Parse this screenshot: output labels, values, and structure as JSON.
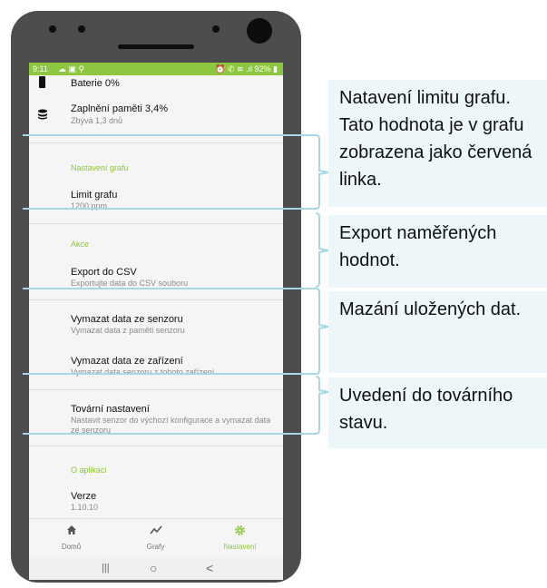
{
  "statusbar": {
    "time": "9:11",
    "left_icons": "☁ ▣ ⚲",
    "right_icons": "⏰ ✆ ≋ .ıl 92% ▮"
  },
  "items": {
    "battery": {
      "title": "Baterie 0%"
    },
    "memory": {
      "title": "Zaplnění paměti 3,4%",
      "subtitle": "Zbývá 1,3 dnů"
    },
    "section_graph": "Nastavení grafu",
    "graph_limit": {
      "title": "Limit grafu",
      "subtitle": "1200 ppm"
    },
    "section_actions": "Akce",
    "export_csv": {
      "title": "Export do CSV",
      "subtitle": "Exportujte data do CSV souboru"
    },
    "clear_sensor": {
      "title": "Vymazat data ze senzoru",
      "subtitle": "Vymazat data z paměti senzoru"
    },
    "clear_device": {
      "title": "Vymazat data ze zařízení",
      "subtitle": "Vymazat data senzoru z tohoto zařízení"
    },
    "factory_reset": {
      "title": "Tovární nastavení",
      "subtitle": "Nastavit senzor do výchozí konfigurace a vymazat data ze senzoru"
    },
    "section_about": "O aplikaci",
    "version": {
      "title": "Verze",
      "subtitle": "1.10.10"
    }
  },
  "bottom_nav": [
    {
      "label": "Domů",
      "icon": "home-icon",
      "glyph": "⌂"
    },
    {
      "label": "Grafy",
      "icon": "chart-icon",
      "glyph": "⟋"
    },
    {
      "label": "Nastavení",
      "icon": "gear-icon",
      "glyph": "⚙",
      "active": true
    }
  ],
  "system_nav": {
    "recent": "|||",
    "home": "○",
    "back": "<"
  },
  "callouts": [
    {
      "text": "Natavení limitu grafu. Tato hodnota je v grafu zobrazena jako červená linka."
    },
    {
      "text": "Export naměřených hodnot."
    },
    {
      "text": "Mazání uložených dat."
    },
    {
      "text": "Uvedení do továrního stavu."
    }
  ],
  "colors": {
    "accent": "#8dc63f",
    "bracket": "#a8d8e3",
    "callout_bg": "#edf6f8"
  }
}
